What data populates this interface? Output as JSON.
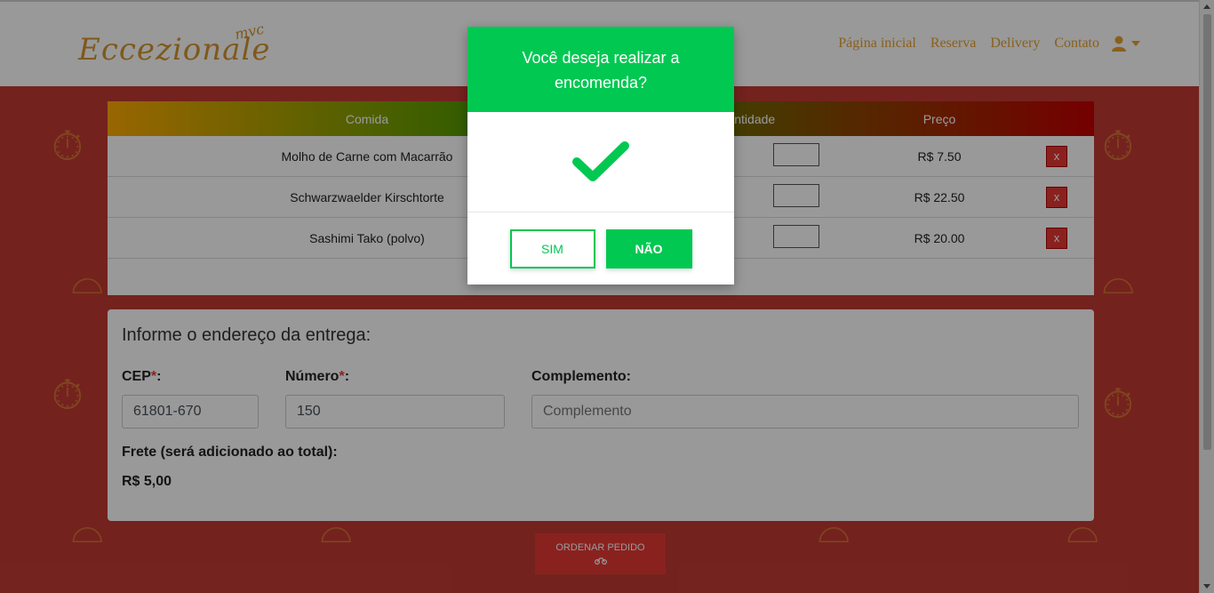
{
  "navbar": {
    "logo_main": "Eccezionale",
    "logo_sub": "mvc",
    "links": [
      "Página inicial",
      "Reserva",
      "Delivery",
      "Contato"
    ]
  },
  "cart": {
    "headers": [
      "Comida",
      "Quantidade",
      "Preço"
    ],
    "rows": [
      {
        "name": "Molho de Carne com Macarrão",
        "price": "R$ 7.50",
        "remove": "x"
      },
      {
        "name": "Schwarzwaelder Kirschtorte",
        "price": "R$ 22.50",
        "remove": "x"
      },
      {
        "name": "Sashimi Tako (polvo)",
        "price": "R$ 20.00",
        "remove": "x"
      }
    ]
  },
  "address": {
    "title": "Informe o endereço da entrega:",
    "cep_label": "CEP",
    "cep_value": "61801-670",
    "numero_label": "Número",
    "numero_value": "150",
    "complemento_label": "Complemento:",
    "complemento_placeholder": "Complemento",
    "required_mark": "*",
    "label_colon": ":",
    "frete_label": "Frete (será adicionado ao total):",
    "frete_value": "R$ 5,00"
  },
  "order_button": {
    "label": "ORDENAR PEDIDO",
    "icon": "motorcycle-icon"
  },
  "modal": {
    "title": "Você deseja realizar a encomenda?",
    "icon": "checkmark-icon",
    "yes_label": "SIM",
    "no_label": "NÃO"
  },
  "colors": {
    "accent_green": "#00c851",
    "brand_orange": "#e6a12e",
    "danger_red": "#e53935"
  }
}
